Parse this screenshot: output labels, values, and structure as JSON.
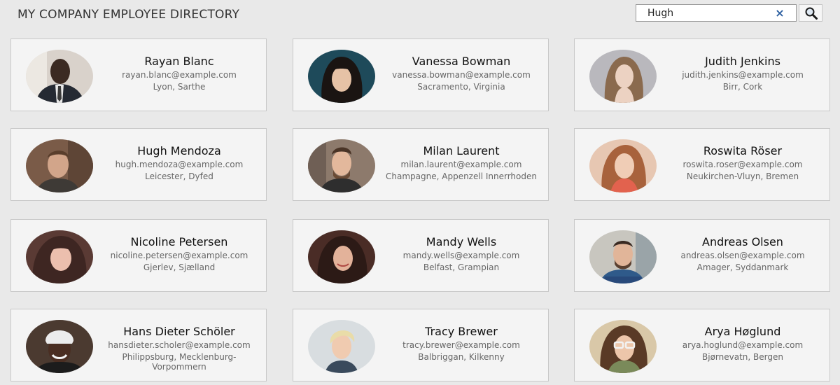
{
  "header": {
    "title": "MY COMPANY EMPLOYEE DIRECTORY"
  },
  "search": {
    "value": "Hugh",
    "clear_glyph": "×",
    "clear_icon": "close-icon",
    "button_icon": "magnifier-icon"
  },
  "employees": [
    {
      "name": "Rayan Blanc",
      "email": "rayan.blanc@example.com",
      "location": "Lyon, Sarthe"
    },
    {
      "name": "Vanessa Bowman",
      "email": "vanessa.bowman@example.com",
      "location": "Sacramento, Virginia"
    },
    {
      "name": "Judith Jenkins",
      "email": "judith.jenkins@example.com",
      "location": "Birr, Cork"
    },
    {
      "name": "Hugh Mendoza",
      "email": "hugh.mendoza@example.com",
      "location": "Leicester, Dyfed"
    },
    {
      "name": "Milan Laurent",
      "email": "milan.laurent@example.com",
      "location": "Champagne, Appenzell Innerrhoden"
    },
    {
      "name": "Roswita Röser",
      "email": "roswita.roser@example.com",
      "location": "Neukirchen-Vluyn, Bremen"
    },
    {
      "name": "Nicoline Petersen",
      "email": "nicoline.petersen@example.com",
      "location": "Gjerlev, Sjælland"
    },
    {
      "name": "Mandy Wells",
      "email": "mandy.wells@example.com",
      "location": "Belfast, Grampian"
    },
    {
      "name": "Andreas Olsen",
      "email": "andreas.olsen@example.com",
      "location": "Amager, Syddanmark"
    },
    {
      "name": "Hans Dieter Schöler",
      "email": "hansdieter.scholer@example.com",
      "location": "Philippsburg, Mecklenburg-Vorpommern"
    },
    {
      "name": "Tracy Brewer",
      "email": "tracy.brewer@example.com",
      "location": "Balbriggan, Kilkenny"
    },
    {
      "name": "Arya Høglund",
      "email": "arya.hoglund@example.com",
      "location": "Bjørnevatn, Bergen"
    }
  ],
  "colors": {
    "background": "#e9e9e9",
    "card": "#f4f4f4",
    "card_border": "#c8c8c8",
    "clear_icon": "#2c5fa0"
  }
}
